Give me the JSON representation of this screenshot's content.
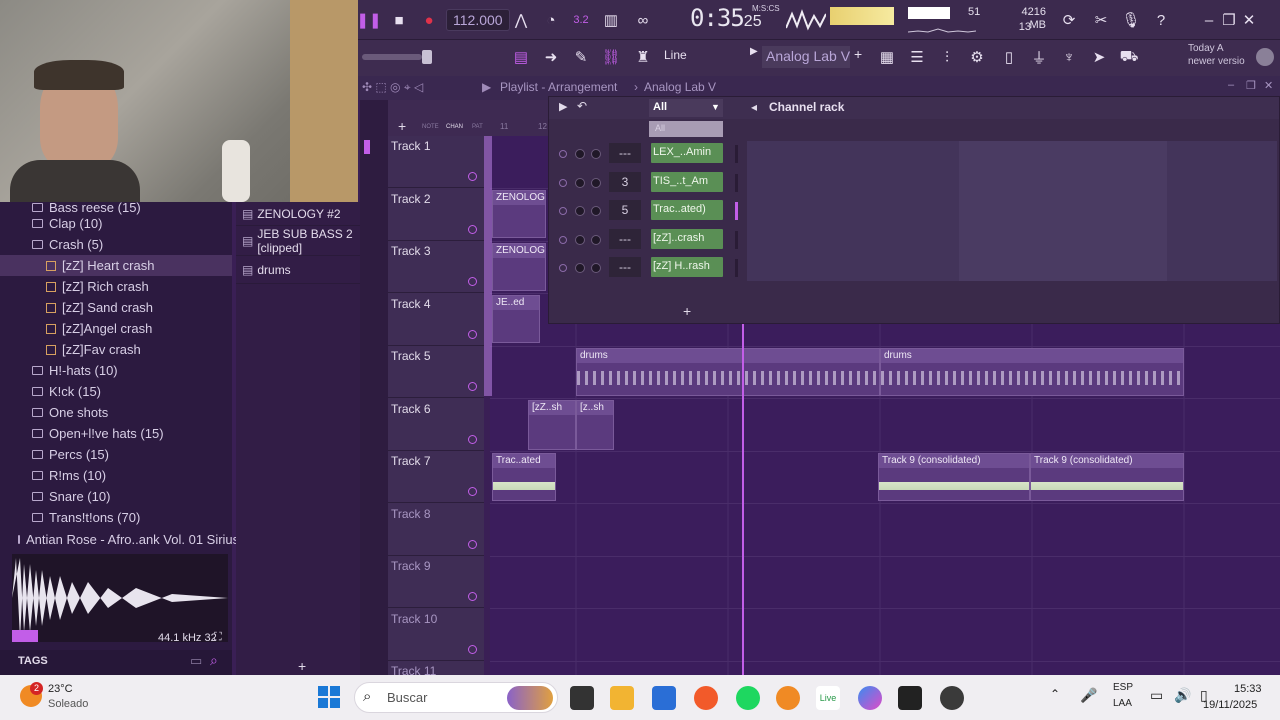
{
  "toolbar": {
    "tempo": "112.000",
    "time": "0:35",
    "time_frac": "25",
    "time_unit": "M:S:CS",
    "pattern": "3",
    "cpu_value": "51",
    "mem_mb": "4216 MB",
    "mem_poly": "13",
    "snap": "Line",
    "plugin": "Analog Lab V",
    "hint_line1": "Today",
    "hint_a": "A",
    "hint_line2": "newer versio",
    "colors": {
      "accent": "#c25ee8",
      "bg": "#3c2a4e"
    }
  },
  "playlist": {
    "title": "Playlist - Arrangement",
    "crumb": "Analog Lab V",
    "header_chan": "CHAN",
    "header_note": "NOTE",
    "header_pat": "PAT",
    "ruler_11": "11",
    "ruler_12": "12",
    "tracks": [
      "Track 1",
      "Track 2",
      "Track 3",
      "Track 4",
      "Track 5",
      "Track 6",
      "Track 7",
      "Track 8",
      "Track 9",
      "Track 10",
      "Track 11"
    ],
    "clips": {
      "drums1": "drums",
      "drums2": "drums",
      "zenolog1": "ZENOLOG",
      "zenolog2": "ZENOLOG",
      "je": "JE..ed",
      "zz1": "[zZ..sh",
      "zz2": "[z..sh",
      "tracated": "Trac..ated",
      "t9a": "Track 9 (consolidated)",
      "t9b": "Track 9 (consolidated)"
    }
  },
  "rack": {
    "title": "Channel rack",
    "filter": "All",
    "filter_option": "All",
    "rows": [
      {
        "num": "---",
        "name": "LEX_..Amin"
      },
      {
        "num": "3",
        "name": "TIS_..t_Am"
      },
      {
        "num": "5",
        "name": "Trac..ated)"
      },
      {
        "num": "---",
        "name": "[zZ]..crash"
      },
      {
        "num": "---",
        "name": "[zZ] H..rash"
      }
    ]
  },
  "picker": {
    "items": [
      "ZENOLOGY #2",
      "JEB SUB BASS 2 [clipped]",
      "drums"
    ]
  },
  "browser": {
    "items": [
      {
        "label": "Bass reese (15)",
        "type": "folder",
        "indent": 1
      },
      {
        "label": "Clap (10)",
        "type": "folder",
        "indent": 1
      },
      {
        "label": "Crash (5)",
        "type": "folder",
        "indent": 1
      },
      {
        "label": "[zZ] Heart crash",
        "type": "file",
        "indent": 2,
        "selected": true
      },
      {
        "label": "[zZ] Rich crash",
        "type": "file",
        "indent": 2
      },
      {
        "label": "[zZ] Sand crash",
        "type": "file",
        "indent": 2
      },
      {
        "label": "[zZ]Angel crash",
        "type": "file",
        "indent": 2
      },
      {
        "label": "[zZ]Fav crash",
        "type": "file",
        "indent": 2
      },
      {
        "label": "H!-hats (10)",
        "type": "folder",
        "indent": 1
      },
      {
        "label": "K!ck (15)",
        "type": "folder",
        "indent": 1
      },
      {
        "label": "One shots",
        "type": "folder",
        "indent": 1
      },
      {
        "label": "Open+l!ve hats (15)",
        "type": "folder",
        "indent": 1
      },
      {
        "label": "Percs (15)",
        "type": "folder",
        "indent": 1
      },
      {
        "label": "R!ms (10)",
        "type": "folder",
        "indent": 1
      },
      {
        "label": "Snare (10)",
        "type": "folder",
        "indent": 1
      },
      {
        "label": "Trans!t!ons (70)",
        "type": "folder",
        "indent": 1
      },
      {
        "label": "Antian Rose - Afro..ank Vol. 01  Sirius",
        "type": "folder",
        "indent": 0
      }
    ],
    "sample_rate": "44.1 kHz 32",
    "tags_label": "TAGS"
  },
  "taskbar": {
    "weather_temp": "23°C",
    "weather_desc": "Soleado",
    "weather_badge": "2",
    "search_placeholder": "Buscar",
    "lang1": "ESP",
    "lang2": "LAA",
    "clock_time": "15:33",
    "clock_date": "19/11/2025"
  }
}
